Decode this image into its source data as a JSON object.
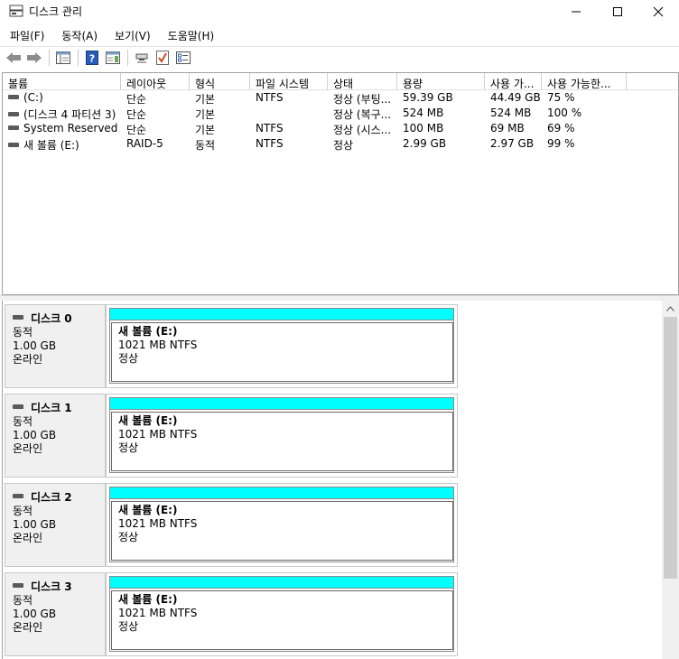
{
  "window": {
    "title": "디스크 관리",
    "controls": {
      "minimize": "—",
      "maximize": "☐",
      "close": "✕"
    }
  },
  "menu": [
    "파일(F)",
    "동작(A)",
    "보기(V)",
    "도움말(H)"
  ],
  "toolbar": {
    "icons": [
      "back-arrow-icon",
      "forward-arrow-icon",
      "properties-icon",
      "help-icon",
      "console-icon",
      "connect-icon",
      "check-icon",
      "settings-icon"
    ]
  },
  "volumes": {
    "columns": [
      "볼륨",
      "레이아웃",
      "형식",
      "파일 시스템",
      "상태",
      "용량",
      "사용 가...",
      "사용 가능한..."
    ],
    "rows": [
      {
        "name": "(C:)",
        "layout": "단순",
        "type": "기본",
        "fs": "NTFS",
        "status": "정상 (부팅...",
        "capacity": "59.39 GB",
        "free": "44.49 GB",
        "pct": "75 %"
      },
      {
        "name": "(디스크 4 파티션 3)",
        "layout": "단순",
        "type": "기본",
        "fs": "",
        "status": "정상 (복구...",
        "capacity": "524 MB",
        "free": "524 MB",
        "pct": "100 %"
      },
      {
        "name": "System Reserved",
        "layout": "단순",
        "type": "기본",
        "fs": "NTFS",
        "status": "정상 (시스...",
        "capacity": "100 MB",
        "free": "69 MB",
        "pct": "69 %"
      },
      {
        "name": "새 볼륨 (E:)",
        "layout": "RAID-5",
        "type": "동적",
        "fs": "NTFS",
        "status": "정상",
        "capacity": "2.99 GB",
        "free": "2.97 GB",
        "pct": "99 %"
      }
    ]
  },
  "disks": [
    {
      "name": "디스크 0",
      "kind": "동적",
      "size": "1.00 GB",
      "state": "온라인",
      "partition": {
        "title": "새 볼륨  (E:)",
        "detail": "1021 MB NTFS",
        "status": "정상"
      }
    },
    {
      "name": "디스크 1",
      "kind": "동적",
      "size": "1.00 GB",
      "state": "온라인",
      "partition": {
        "title": "새 볼륨  (E:)",
        "detail": "1021 MB NTFS",
        "status": "정상"
      }
    },
    {
      "name": "디스크 2",
      "kind": "동적",
      "size": "1.00 GB",
      "state": "온라인",
      "partition": {
        "title": "새 볼륨  (E:)",
        "detail": "1021 MB NTFS",
        "status": "정상"
      }
    },
    {
      "name": "디스크 3",
      "kind": "동적",
      "size": "1.00 GB",
      "state": "온라인",
      "partition": {
        "title": "새 볼륨  (E:)",
        "detail": "1021 MB NTFS",
        "status": "정상"
      }
    }
  ],
  "colors": {
    "raid5_bar": "#00ffff",
    "window_bg": "#ffffff",
    "label_bg": "#f0f0f0"
  }
}
